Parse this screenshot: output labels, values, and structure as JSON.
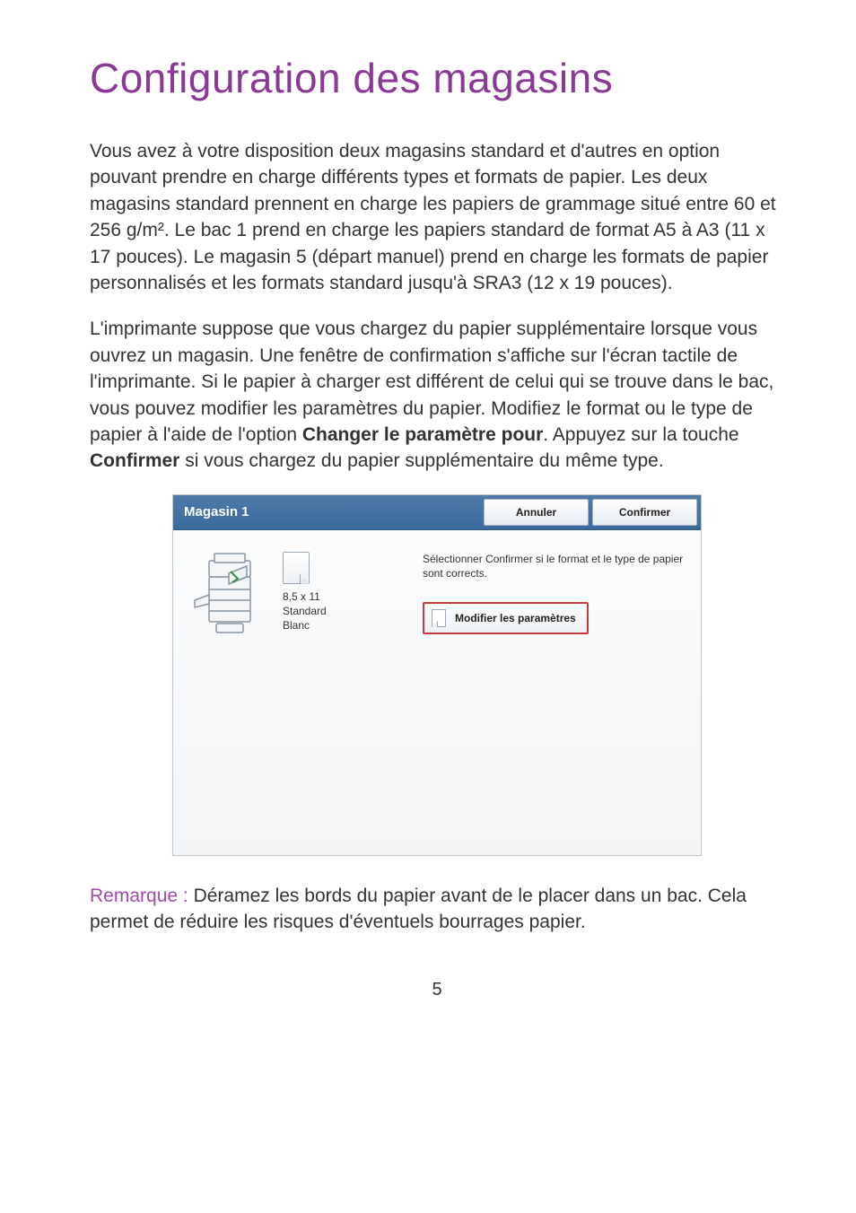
{
  "title": "Configuration des magasins",
  "para1": {
    "text": "Vous avez à votre disposition deux magasins standard et d'autres en option pouvant prendre en charge différents types et formats de papier. Les deux magasins standard prennent en charge les papiers de grammage situé entre 60 et 256 g/m². Le bac 1 prend en charge les papiers standard de format A5 à A3 (11 x 17 pouces). Le magasin 5 (départ manuel) prend en charge les formats de papier personnalisés et les formats standard jusqu'à SRA3 (12 x 19 pouces)."
  },
  "para2": {
    "pre": "L'imprimante suppose que vous chargez du papier supplémentaire lorsque vous ouvrez un magasin. Une fenêtre de confirmation s'affiche sur l'écran tactile de l'imprimante. Si le papier à charger est différent de celui qui se trouve dans le bac, vous pouvez modifier les paramètres du papier. Modifiez le format ou le type de papier à l'aide de l'option ",
    "bold1": "Changer le paramètre pour",
    "mid": ". Appuyez sur la touche ",
    "bold2": "Confirmer",
    "post": " si vous chargez du papier supplémentaire du même type."
  },
  "dialog": {
    "title": "Magasin 1",
    "cancel": "Annuler",
    "confirm": "Confirmer",
    "paper": {
      "size": "8,5 x 11",
      "type": "Standard",
      "color": "Blanc"
    },
    "instruction": "Sélectionner Confirmer si le format et le type de papier sont corrects.",
    "modify": "Modifier les paramètres"
  },
  "note": {
    "label": "Remarque : ",
    "text": "Déramez les bords du papier avant de le placer dans un bac. Cela permet de réduire les risques d'éventuels bourrages papier."
  },
  "pageNumber": "5"
}
